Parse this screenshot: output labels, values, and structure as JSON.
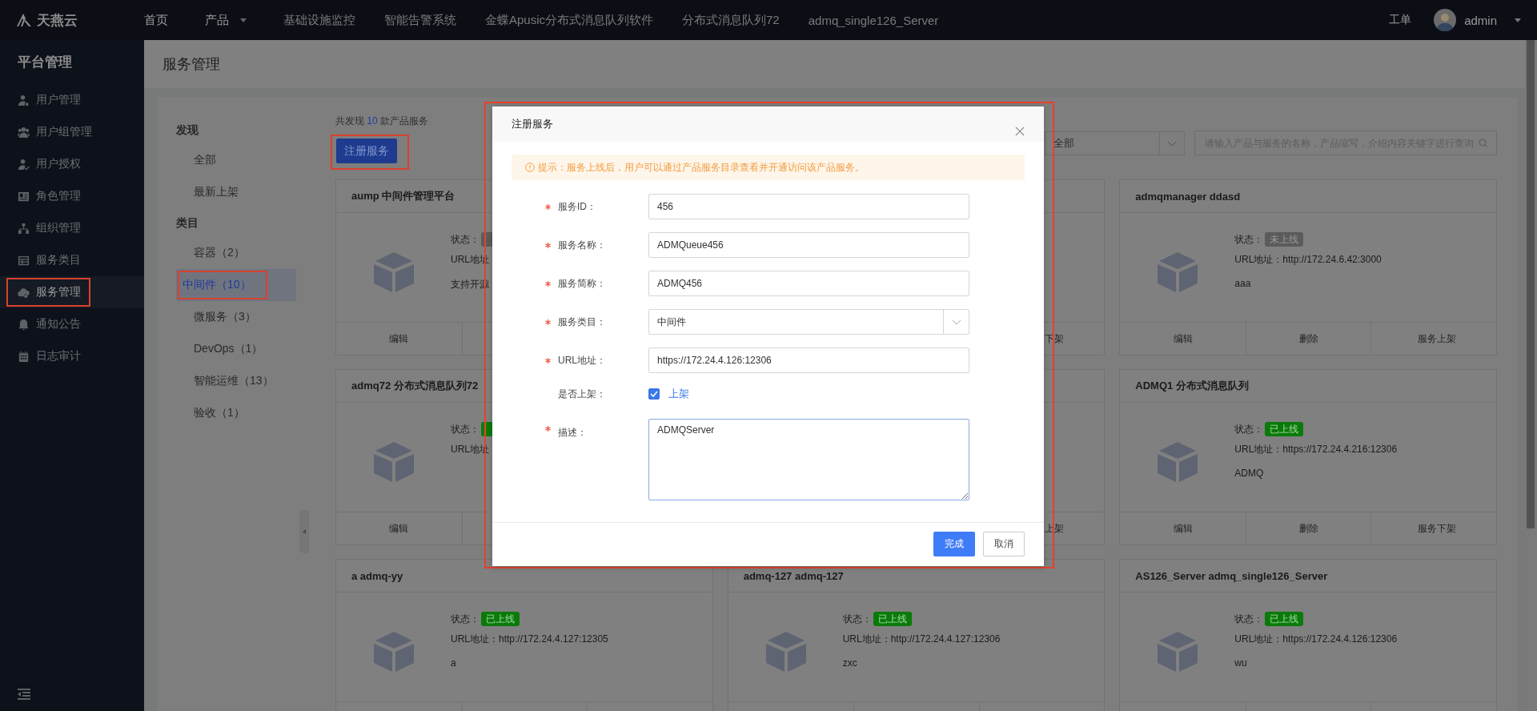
{
  "topbar": {
    "logo": "天燕云",
    "nav": [
      {
        "label": "首页",
        "kind": "primary",
        "dropdown": false
      },
      {
        "label": "产品",
        "kind": "primary",
        "dropdown": true
      },
      {
        "label": "基础设施监控",
        "kind": "recent",
        "dropdown": false
      },
      {
        "label": "智能告警系统",
        "kind": "recent",
        "dropdown": false
      },
      {
        "label": "金蝶Apusic分布式消息队列软件",
        "kind": "recent",
        "dropdown": false
      },
      {
        "label": "分布式消息队列72",
        "kind": "recent",
        "dropdown": false
      },
      {
        "label": "admq_single126_Server",
        "kind": "recent",
        "dropdown": false
      }
    ],
    "ticket": "工单",
    "user": "admin"
  },
  "sidebar": {
    "title": "平台管理",
    "items": [
      {
        "label": "用户管理",
        "selected": false,
        "highlighted": false
      },
      {
        "label": "用户组管理",
        "selected": false,
        "highlighted": false
      },
      {
        "label": "用户授权",
        "selected": false,
        "highlighted": false
      },
      {
        "label": "角色管理",
        "selected": false,
        "highlighted": false
      },
      {
        "label": "组织管理",
        "selected": false,
        "highlighted": false
      },
      {
        "label": "服务类目",
        "selected": false,
        "highlighted": false
      },
      {
        "label": "服务管理",
        "selected": true,
        "highlighted": true
      },
      {
        "label": "通知公告",
        "selected": false,
        "highlighted": false
      },
      {
        "label": "日志审计",
        "selected": false,
        "highlighted": false
      }
    ]
  },
  "page": {
    "title": "服务管理"
  },
  "categories": [
    {
      "heading": "发现",
      "items": [
        {
          "label": "全部",
          "selected": false,
          "highlighted": false
        },
        {
          "label": "最新上架",
          "selected": false,
          "highlighted": false
        }
      ]
    },
    {
      "heading": "类目",
      "items": [
        {
          "label": "容器（2）",
          "selected": false,
          "highlighted": false
        },
        {
          "label": "中间件（10）",
          "selected": true,
          "highlighted": true
        },
        {
          "label": "微服务（3）",
          "selected": false,
          "highlighted": false
        },
        {
          "label": "DevOps（1）",
          "selected": false,
          "highlighted": false
        },
        {
          "label": "智能运维（13）",
          "selected": false,
          "highlighted": false
        },
        {
          "label": "验收（1）",
          "selected": false,
          "highlighted": false
        }
      ]
    }
  ],
  "toolbar": {
    "summary_prefix": "共发现",
    "count": "10",
    "summary_suffix": "款产品服务",
    "register_button": {
      "label": "注册服务",
      "highlighted": true
    },
    "filter": {
      "value": "全部"
    },
    "search": {
      "placeholder": "请输入产品与服务的名称，产品缩写，介绍内容关键字进行查询"
    }
  },
  "cards": [
    {
      "title": "aump 中间件管理平台",
      "status_label": "状态：",
      "status": {
        "online": false
      },
      "url": "URL地址",
      "description": "支持开源",
      "actions": [
        {
          "kind": "edit",
          "label": "编辑"
        }
      ]
    },
    {
      "actions": [
        {
          "kind": "toggle",
          "label": "下架"
        }
      ]
    },
    {
      "title": "admqmanager ddasd",
      "status_label": "状态：",
      "status": {
        "online": false,
        "label": "未上线"
      },
      "url": "URL地址：http://172.24.6.42:3000",
      "description": "aaa",
      "actions": [
        {
          "kind": "edit",
          "label": "编辑"
        },
        {
          "kind": "delete",
          "label": "删除"
        },
        {
          "kind": "toggle",
          "label": "服务上架"
        }
      ]
    },
    {
      "title": "admq72 分布式消息队列72",
      "status_label": "状态：",
      "status": {
        "online": true
      },
      "url": "URL地址",
      "actions": [
        {
          "kind": "edit",
          "label": "编辑"
        }
      ]
    },
    {
      "actions": [
        {
          "kind": "toggle",
          "label": "上架"
        }
      ]
    },
    {
      "title": "ADMQ1 分布式消息队列",
      "status_label": "状态：",
      "status": {
        "online": true,
        "label": "已上线"
      },
      "url": "URL地址：https://172.24.4.216:12306",
      "description": "ADMQ",
      "actions": [
        {
          "kind": "edit",
          "label": "编辑"
        },
        {
          "kind": "delete",
          "label": "删除"
        },
        {
          "kind": "toggle",
          "label": "服务下架"
        }
      ]
    },
    {
      "title": "a admq-yy",
      "status_label": "状态：",
      "status": {
        "online": true,
        "label": "已上线"
      },
      "url": "URL地址：http://172.24.4.127:12305",
      "description": "a"
    },
    {
      "title": "admq-127 admq-127",
      "status_label": "状态：",
      "status": {
        "online": true,
        "label": "已上线"
      },
      "url": "URL地址：http://172.24.4.127:12306",
      "description": "zxc"
    },
    {
      "title": "AS126_Server admq_single126_Server",
      "status_label": "状态：",
      "status": {
        "online": true,
        "label": "已上线"
      },
      "url": "URL地址：https://172.24.4.126:12306",
      "description": "wu"
    }
  ],
  "modal": {
    "title": "注册服务",
    "highlighted": true,
    "notice": "提示：服务上线后，用户可以通过产品服务目录查看并开通访问该产品服务。",
    "fields": [
      {
        "kind": "text",
        "label": "服务ID：",
        "required": true,
        "value": "456"
      },
      {
        "kind": "text",
        "label": "服务名称：",
        "required": true,
        "value": "ADMQueue456"
      },
      {
        "kind": "text",
        "label": "服务简称：",
        "required": true,
        "value": "ADMQ456"
      },
      {
        "kind": "select",
        "label": "服务类目：",
        "required": true,
        "value": "中间件"
      },
      {
        "kind": "text",
        "label": "URL地址：",
        "required": true,
        "value": "https://172.24.4.126:12306"
      },
      {
        "kind": "checkbox",
        "label": "是否上架：",
        "required": false,
        "checked": true,
        "option": "上架"
      },
      {
        "kind": "textarea",
        "label": "描述：",
        "required": true,
        "value": "ADMQServer"
      }
    ],
    "buttons": [
      {
        "label": "完成",
        "kind": "primary"
      },
      {
        "label": "取消",
        "kind": "default"
      }
    ]
  }
}
